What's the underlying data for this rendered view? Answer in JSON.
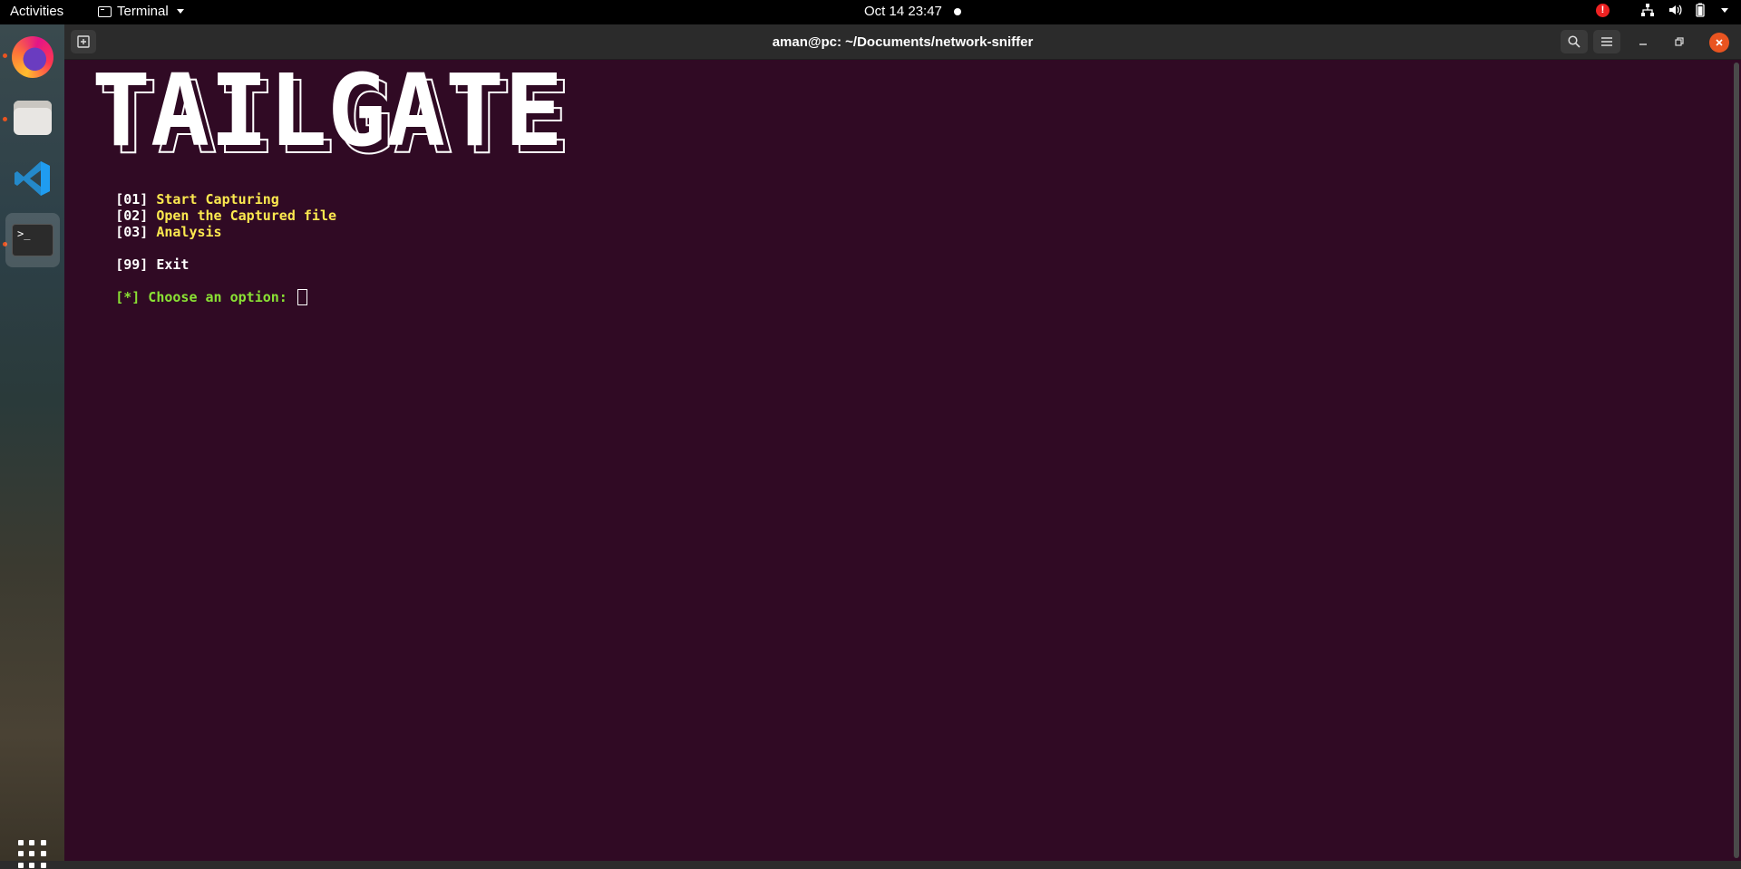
{
  "topbar": {
    "activities": "Activities",
    "app_name": "Terminal",
    "datetime": "Oct 14  23:47",
    "alert_badge": "!"
  },
  "dock": {
    "apps": [
      {
        "name": "Firefox",
        "icon": "firefox-icon",
        "running": true
      },
      {
        "name": "Files",
        "icon": "files-icon",
        "running": true
      },
      {
        "name": "Visual Studio Code",
        "icon": "vscode-icon",
        "running": false
      },
      {
        "name": "Terminal",
        "icon": "terminal-icon",
        "running": true,
        "active": true,
        "glyph": ">_"
      }
    ],
    "show_apps_icon": "app-grid-icon"
  },
  "window": {
    "title": "aman@pc: ~/Documents/network-sniffer"
  },
  "terminal": {
    "banner": "TAILGATE",
    "menu": [
      {
        "bracket": "[01]",
        "label": "Start Capturing"
      },
      {
        "bracket": "[02]",
        "label": "Open the Captured file"
      },
      {
        "bracket": "[03]",
        "label": "Analysis"
      }
    ],
    "exit_item": {
      "bracket": "[99]",
      "label": "Exit"
    },
    "prompt": "[*] Choose an option: "
  },
  "colors": {
    "terminal_bg": "#300a24",
    "menu_text": "#fce94f",
    "prompt_text": "#8ae234",
    "accent": "#e95420"
  }
}
